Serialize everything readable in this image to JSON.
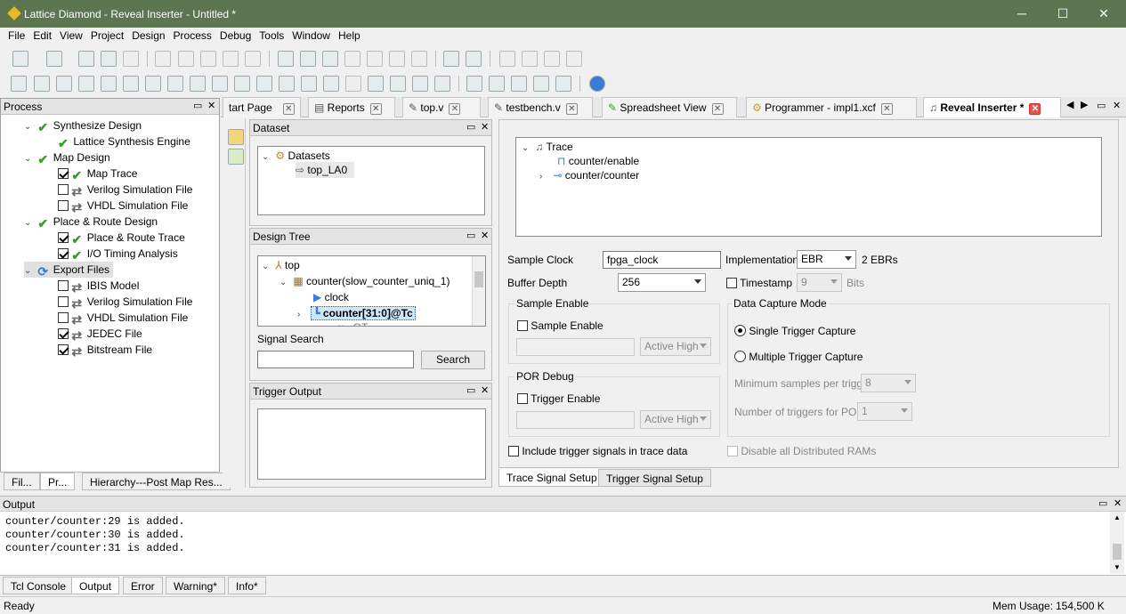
{
  "window": {
    "title": "Lattice Diamond - Reveal Inserter - Untitled *",
    "minimize": "─",
    "maximize": "☐",
    "close": "✕"
  },
  "menu": [
    "File",
    "Edit",
    "View",
    "Project",
    "Design",
    "Process",
    "Debug",
    "Tools",
    "Window",
    "Help"
  ],
  "process_panel": {
    "title": "Process",
    "items": [
      {
        "label": "Synthesize Design",
        "indent": 0,
        "checkbox": null,
        "status": "done",
        "expanded": true
      },
      {
        "label": "Lattice Synthesis Engine",
        "indent": 1,
        "checkbox": null,
        "status": "done"
      },
      {
        "label": "Map Design",
        "indent": 0,
        "checkbox": null,
        "status": "done",
        "expanded": true
      },
      {
        "label": "Map Trace",
        "indent": 1,
        "checkbox": true,
        "status": "done"
      },
      {
        "label": "Verilog Simulation File",
        "indent": 1,
        "checkbox": false,
        "status": "pending"
      },
      {
        "label": "VHDL Simulation File",
        "indent": 1,
        "checkbox": false,
        "status": "pending"
      },
      {
        "label": "Place & Route Design",
        "indent": 0,
        "checkbox": null,
        "status": "done",
        "expanded": true
      },
      {
        "label": "Place & Route Trace",
        "indent": 1,
        "checkbox": true,
        "status": "done"
      },
      {
        "label": "I/O Timing Analysis",
        "indent": 1,
        "checkbox": true,
        "status": "done"
      },
      {
        "label": "Export Files",
        "indent": 0,
        "checkbox": null,
        "status": "running",
        "expanded": true
      },
      {
        "label": "IBIS Model",
        "indent": 1,
        "checkbox": false,
        "status": "pending"
      },
      {
        "label": "Verilog Simulation File",
        "indent": 1,
        "checkbox": false,
        "status": "pending"
      },
      {
        "label": "VHDL Simulation File",
        "indent": 1,
        "checkbox": false,
        "status": "pending"
      },
      {
        "label": "JEDEC File",
        "indent": 1,
        "checkbox": true,
        "status": "pending"
      },
      {
        "label": "Bitstream File",
        "indent": 1,
        "checkbox": true,
        "status": "pending"
      }
    ],
    "tabs": [
      "Fil...",
      "Pr...",
      "Hierarchy---Post Map Res..."
    ]
  },
  "doc_tabs": [
    {
      "label": "tart Page"
    },
    {
      "label": "Reports"
    },
    {
      "label": "top.v"
    },
    {
      "label": "testbench.v"
    },
    {
      "label": "Spreadsheet View"
    },
    {
      "label": "Programmer - impl1.xcf"
    },
    {
      "label": "Reveal Inserter *"
    }
  ],
  "dataset": {
    "title": "Dataset",
    "root": "Datasets",
    "child": "top_LA0"
  },
  "design_tree": {
    "title": "Design Tree",
    "nodes": [
      "top",
      "counter(slow_counter_uniq_1)",
      "clock",
      "counter[31:0]@Tc",
      "...u...OT..."
    ],
    "signal_search_label": "Signal Search",
    "search_value": "",
    "search_button": "Search"
  },
  "trigger_output": {
    "title": "Trigger Output"
  },
  "trace_tree": {
    "root": "Trace",
    "children": [
      "counter/enable",
      "counter/counter"
    ]
  },
  "trace_setup": {
    "sample_clock_label": "Sample Clock",
    "sample_clock_value": "fpga_clock",
    "implementation_label": "Implementation",
    "implementation_value": "EBR",
    "ebr_count": "2 EBRs",
    "buffer_depth_label": "Buffer Depth",
    "buffer_depth_value": "256",
    "timestamp_label": "Timestamp",
    "timestamp_value": "9",
    "bits_label": "Bits",
    "sample_enable_group": "Sample Enable",
    "sample_enable_check": "Sample Enable",
    "sample_active": "Active High",
    "por_group": "POR Debug",
    "trigger_enable_check": "Trigger Enable",
    "por_active": "Active High",
    "capture_group": "Data Capture Mode",
    "single_trigger": "Single Trigger Capture",
    "multiple_trigger": "Multiple Trigger Capture",
    "min_samples_label": "Minimum samples per trigger",
    "min_samples_value": "8",
    "num_triggers_label": "Number of triggers for POR",
    "num_triggers_value": "1",
    "include_trigger": "Include trigger signals in trace data",
    "disable_rams": "Disable all Distributed RAMs"
  },
  "setup_tabs": [
    "Trace Signal Setup",
    "Trigger Signal Setup"
  ],
  "output": {
    "title": "Output",
    "lines": [
      "counter/counter:29 is added.",
      "counter/counter:30 is added.",
      "counter/counter:31 is added."
    ],
    "tabs": [
      "Tcl Console",
      "Output",
      "Error",
      "Warning*",
      "Info*"
    ]
  },
  "status": {
    "left": "Ready",
    "mem_label": "Mem Usage:",
    "mem_value": "154,500 K"
  },
  "colors": {
    "titlebar": "#5e7552",
    "check_green": "#3a9b2c",
    "selection": "#cce8ff"
  }
}
